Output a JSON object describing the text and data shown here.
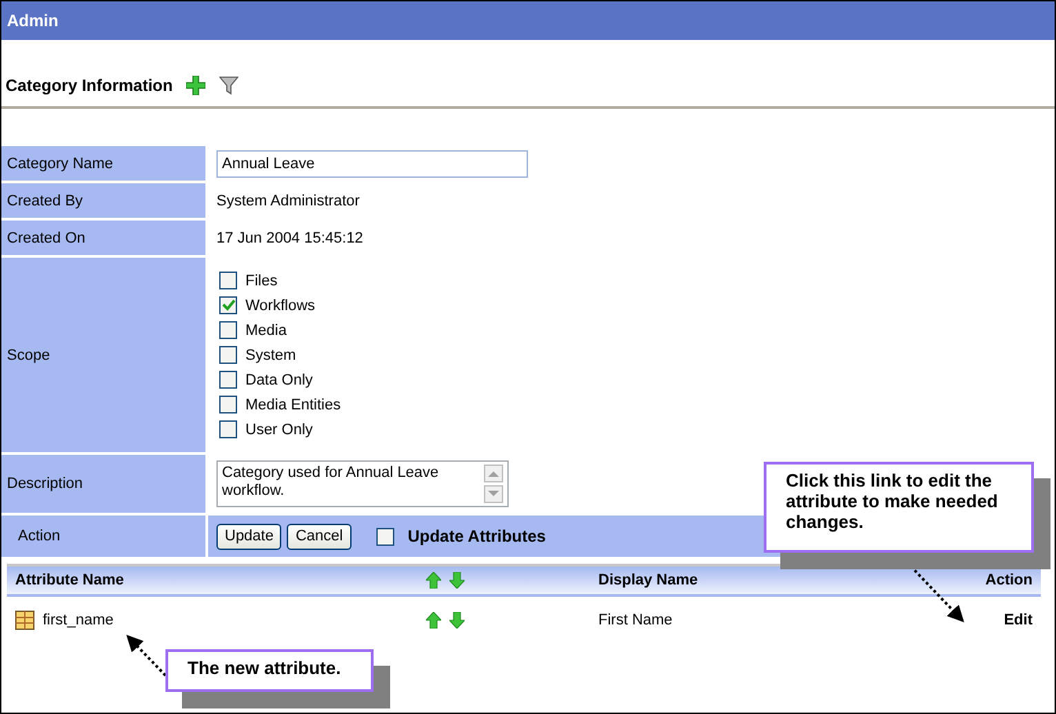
{
  "header": {
    "title": "Admin"
  },
  "section": {
    "title": "Category Information"
  },
  "form": {
    "rows": [
      {
        "kind": "input",
        "label": "Category Name",
        "value": "Annual Leave"
      },
      {
        "kind": "text",
        "label": "Created By",
        "value": "System Administrator"
      },
      {
        "kind": "text",
        "label": "Created On",
        "value": "17 Jun 2004 15:45:12"
      },
      {
        "kind": "checkboxes",
        "label": "Scope",
        "options": [
          {
            "label": "Files",
            "checked": false
          },
          {
            "label": "Workflows",
            "checked": true
          },
          {
            "label": "Media",
            "checked": false
          },
          {
            "label": "System",
            "checked": false
          },
          {
            "label": "Data Only",
            "checked": false
          },
          {
            "label": "Media Entities",
            "checked": false
          },
          {
            "label": "User Only",
            "checked": false
          }
        ]
      },
      {
        "kind": "textarea",
        "label": "Description",
        "value": "Category used for Annual Leave workflow."
      },
      {
        "kind": "actions",
        "label": "Action",
        "buttons": [
          "Update",
          "Cancel"
        ],
        "checkbox": {
          "label": "Update Attributes",
          "checked": false
        }
      }
    ]
  },
  "attributes": {
    "columns": [
      "Attribute Name",
      "Display Name",
      "Action"
    ],
    "rows": [
      {
        "name": "first_name",
        "display_name": "First Name",
        "action": "Edit"
      }
    ]
  },
  "callouts": [
    "Click this link to edit the attribute to make needed changes.",
    "The new attribute."
  ]
}
